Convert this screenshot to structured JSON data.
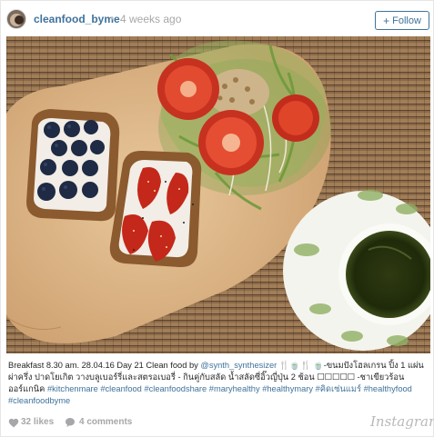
{
  "header": {
    "username": "cleanfood_byme",
    "separator": "•",
    "time_ago": "4 weeks ago",
    "follow_label": "Follow",
    "follow_plus": "+"
  },
  "photo": {
    "subject": "breakfast toast with blueberries and strawberries, salad, green tea on wooden board and bamboo mat"
  },
  "caption": {
    "text_start": "Breakfast 8.30 am. 28.04.16 Day 21 Clean food by ",
    "mention": "@synth_synthesizer",
    "text_mid": " 🍴🍵🍴 🍵-ขนมปังโฮลเกรน ปิ้ง 1 แผ่น ผ่าครึ่ง ปาดโยเกิต วางบลูเบอร์รี่และสตรอเบอรี่ - กินคู่กับสลัด น้ำสลัดซี่อิ๊วญี่ปุ่น 2 ช้อน ☐☐☐☐☐ -ชาเขียวร้อนออร์แกนิค ",
    "hashtags": [
      "#kitchenmare",
      "#cleanfood",
      "#cleanfoodshare",
      "#maryhealthy",
      "#healthymary",
      "#คิดเซ่นแมร์",
      "#healthyfood",
      "#cleanfoodbyme"
    ]
  },
  "footer": {
    "likes": "32 likes",
    "comments": "4 comments",
    "brand": "Instagram"
  },
  "colors": {
    "link": "#3f729b",
    "muted": "#a5a7aa",
    "text": "#262626"
  }
}
